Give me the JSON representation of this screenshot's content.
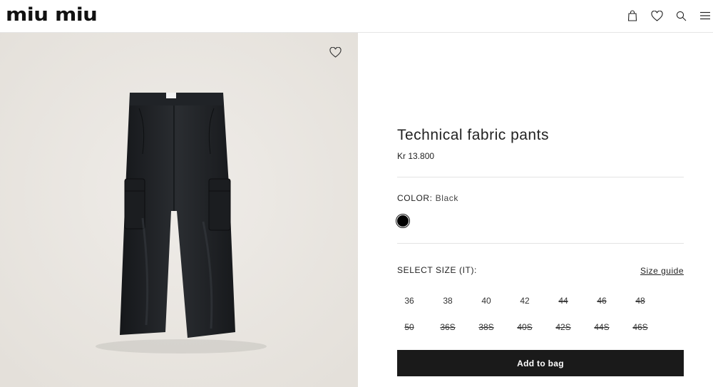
{
  "header": {
    "logo": "miu miu",
    "icons": [
      "shopping-bag-icon",
      "heart-icon",
      "search-icon",
      "menu-icon"
    ]
  },
  "product": {
    "title": "Technical fabric pants",
    "price": "Kr 13.800",
    "color_label": "COLOR:",
    "color_value": "Black",
    "swatch_color": "#000000",
    "image_bg": "#e9e6e1",
    "product_color": "#1d1f22"
  },
  "sizes": {
    "label": "SELECT SIZE (IT):",
    "guide": "Size guide",
    "options": [
      {
        "label": "36",
        "available": true
      },
      {
        "label": "38",
        "available": true
      },
      {
        "label": "40",
        "available": true
      },
      {
        "label": "42",
        "available": true
      },
      {
        "label": "44",
        "available": false
      },
      {
        "label": "46",
        "available": false
      },
      {
        "label": "48",
        "available": false
      },
      {
        "label": "50",
        "available": false
      },
      {
        "label": "36S",
        "available": false
      },
      {
        "label": "38S",
        "available": false
      },
      {
        "label": "40S",
        "available": false
      },
      {
        "label": "42S",
        "available": false
      },
      {
        "label": "44S",
        "available": false
      },
      {
        "label": "46S",
        "available": false
      }
    ]
  },
  "actions": {
    "add_to_bag": "Add to bag"
  }
}
